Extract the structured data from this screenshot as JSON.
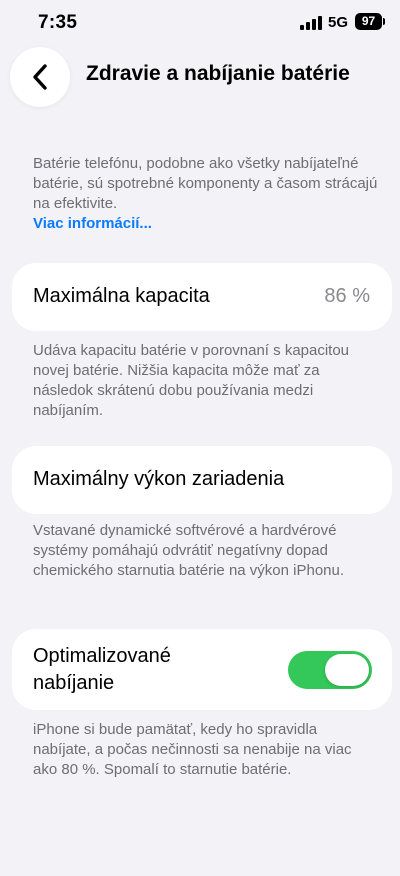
{
  "status_bar": {
    "time": "7:35",
    "network": "5G",
    "battery": "97"
  },
  "header": {
    "title": "Zdravie a nabíjanie batérie"
  },
  "intro": {
    "text": "Batérie telefónu, podobne ako všetky nabíjateľné batérie, sú spotrebné komponenty a časom strácajú na efektivite.",
    "link": "Viac informácií..."
  },
  "capacity": {
    "label": "Maximálna kapacita",
    "value": "86 %",
    "description": "Udáva kapacitu batérie v porovnaní s kapacitou novej batérie. Nižšia kapacita môže mať za následok skrátenú dobu používania medzi nabíjaním."
  },
  "performance": {
    "label": "Maximálny výkon zariadenia",
    "description": "Vstavané dynamické softvérové a hardvérové systémy pomáhajú odvrátiť negatívny dopad chemického starnutia batérie na výkon iPhonu."
  },
  "optimized": {
    "label": "Optimalizované nabíjanie",
    "enabled": true,
    "description": "iPhone si bude pamätať, kedy ho spravidla nabíjate, a počas nečinnosti sa nenabije na viac ako 80 %. Spomalí to starnutie batérie."
  },
  "colors": {
    "accent": "#0a7aff",
    "toggle_on": "#34c759",
    "background": "#f2f2f7"
  }
}
